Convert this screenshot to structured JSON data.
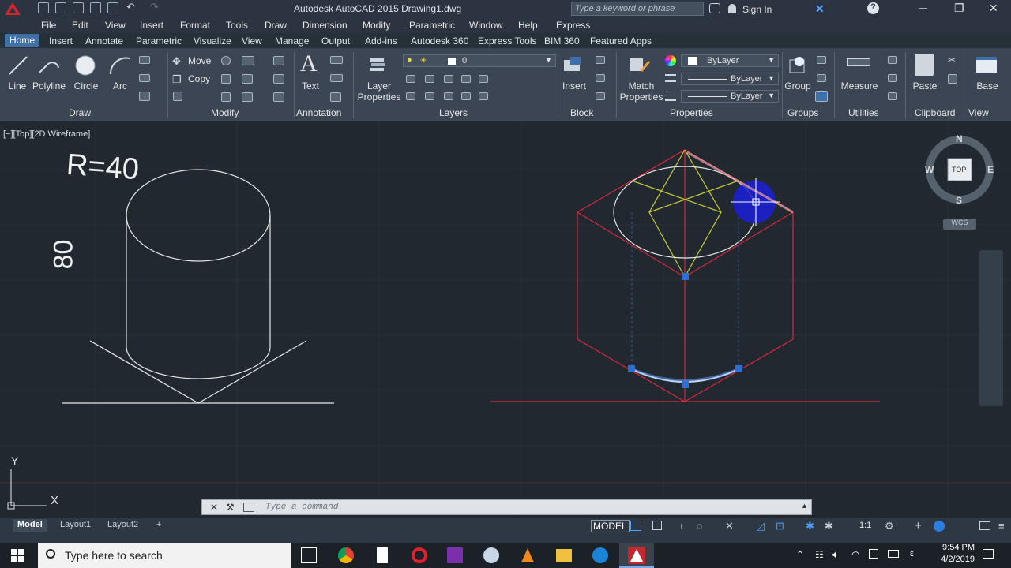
{
  "titlebar": {
    "title": "Autodesk AutoCAD 2015    Drawing1.dwg",
    "search_placeholder": "Type a keyword or phrase",
    "sign_in": "Sign In"
  },
  "menu": [
    "File",
    "Edit",
    "View",
    "Insert",
    "Format",
    "Tools",
    "Draw",
    "Dimension",
    "Modify",
    "Parametric",
    "Window",
    "Help",
    "Express"
  ],
  "tabs": [
    "Home",
    "Insert",
    "Annotate",
    "Parametric",
    "Visualize",
    "View",
    "Manage",
    "Output",
    "Add-ins",
    "Autodesk 360",
    "Express Tools",
    "BIM 360",
    "Featured Apps"
  ],
  "ribbon": {
    "draw": {
      "title": "Draw",
      "line": "Line",
      "polyline": "Polyline",
      "circle": "Circle",
      "arc": "Arc"
    },
    "modify": {
      "title": "Modify",
      "move": "Move",
      "copy": "Copy"
    },
    "annotation": {
      "title": "Annotation",
      "text": "Text"
    },
    "layers": {
      "title": "Layers",
      "layer_properties_1": "Layer",
      "layer_properties_2": "Properties",
      "current_layer": "0"
    },
    "block": {
      "title": "Block",
      "insert": "Insert"
    },
    "properties": {
      "title": "Properties",
      "match_1": "Match",
      "match_2": "Properties",
      "color": "ByLayer",
      "linetype": "ByLayer",
      "lineweight": "ByLayer"
    },
    "groups": {
      "title": "Groups",
      "group": "Group"
    },
    "utilities": {
      "title": "Utilities",
      "measure": "Measure"
    },
    "clipboard": {
      "title": "Clipboard",
      "paste": "Paste"
    },
    "view": {
      "title": "View",
      "base": "Base"
    }
  },
  "viewport": {
    "label": "[−][Top][2D Wireframe]",
    "text_r": "R=40",
    "text_h": "80",
    "compass": {
      "n": "N",
      "s": "S",
      "e": "E",
      "w": "W",
      "top": "TOP",
      "wcs": "WCS"
    },
    "ucs": {
      "x": "X",
      "y": "Y"
    },
    "colors": {
      "bg": "#212830",
      "red": "#d8283c",
      "yellow": "#c8c83c",
      "white": "#e8e8e8",
      "grip": "#2a6fd8"
    }
  },
  "command": {
    "placeholder": "Type a command"
  },
  "layouts": {
    "model": "Model",
    "layout1": "Layout1",
    "layout2": "Layout2"
  },
  "status": {
    "model": "MODEL",
    "scale": "1:1"
  },
  "taskbar": {
    "search": "Type here to search",
    "time": "9:54 PM",
    "date": "4/2/2019"
  }
}
